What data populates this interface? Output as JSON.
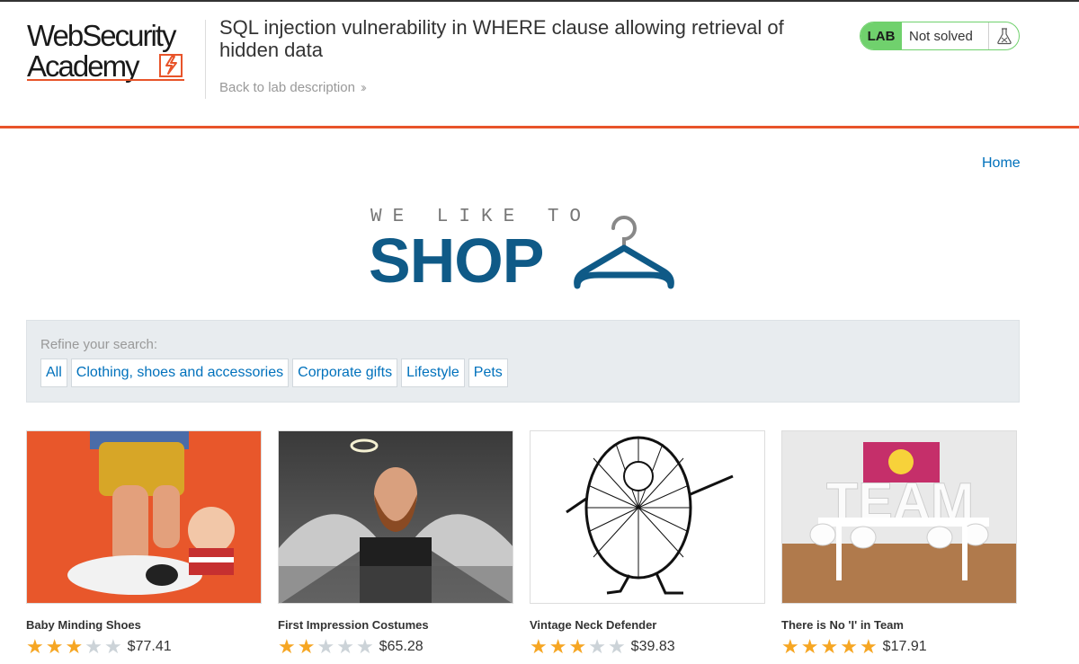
{
  "header": {
    "logo_line1": "WebSecurity",
    "logo_line2": "Academy",
    "lab_title": "SQL injection vulnerability in WHERE clause allowing retrieval of hidden data",
    "back_link": "Back to lab description",
    "status_tag": "LAB",
    "status_text": "Not solved"
  },
  "nav": {
    "home": "Home"
  },
  "shop_logo": {
    "tagline": "WE LIKE TO",
    "word": "SHOP"
  },
  "refine": {
    "label": "Refine your search:",
    "filters": [
      "All",
      "Clothing, shoes and accessories",
      "Corporate gifts",
      "Lifestyle",
      "Pets"
    ]
  },
  "products": [
    {
      "name": "Baby Minding Shoes",
      "rating": 3,
      "max_rating": 5,
      "price": "$77.41"
    },
    {
      "name": "First Impression Costumes",
      "rating": 2,
      "max_rating": 5,
      "price": "$65.28"
    },
    {
      "name": "Vintage Neck Defender",
      "rating": 3,
      "max_rating": 5,
      "price": "$39.83"
    },
    {
      "name": "There is No 'I' in Team",
      "rating": 5,
      "max_rating": 5,
      "price": "$17.91"
    }
  ],
  "colors": {
    "accent_orange": "#e8542a",
    "lab_green": "#70d16d",
    "link_blue": "#0071bc",
    "shop_blue": "#0f5a87",
    "star_gold": "#f6a623"
  }
}
